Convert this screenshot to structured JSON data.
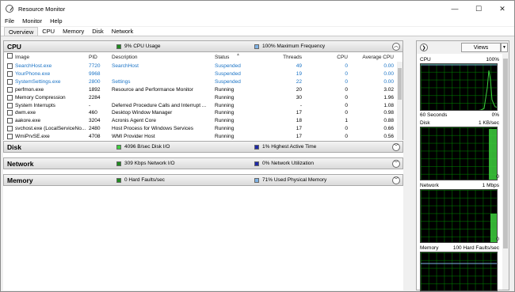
{
  "window": {
    "title": "Resource Monitor",
    "controls": [
      "—",
      "☐",
      "✕"
    ]
  },
  "menu": [
    "File",
    "Monitor",
    "Help"
  ],
  "tabs": [
    "Overview",
    "CPU",
    "Memory",
    "Disk",
    "Network"
  ],
  "cpu": {
    "title": "CPU",
    "stat1": "9% CPU Usage",
    "stat2": "100% Maximum Frequency",
    "stat1_color": "#1f8a1f",
    "stat2_color": "#7fb3e6",
    "columns": [
      "Image",
      "PID",
      "Description",
      "Status",
      "Threads",
      "CPU",
      "Average CPU"
    ],
    "rows": [
      {
        "image": "SearchHost.exe",
        "pid": "7720",
        "desc": "SearchHost",
        "status": "Suspended",
        "threads": "49",
        "cpu": "0",
        "avg": "0.00"
      },
      {
        "image": "YourPhone.exe",
        "pid": "9968",
        "desc": "",
        "status": "Suspended",
        "threads": "19",
        "cpu": "0",
        "avg": "0.00"
      },
      {
        "image": "SystemSettings.exe",
        "pid": "2800",
        "desc": "Settings",
        "status": "Suspended",
        "threads": "22",
        "cpu": "0",
        "avg": "0.00"
      },
      {
        "image": "perfmon.exe",
        "pid": "1892",
        "desc": "Resource and Performance Monitor",
        "status": "Running",
        "threads": "20",
        "cpu": "0",
        "avg": "3.02"
      },
      {
        "image": "Memory Compression",
        "pid": "2284",
        "desc": "",
        "status": "Running",
        "threads": "30",
        "cpu": "0",
        "avg": "1.96"
      },
      {
        "image": "System Interrupts",
        "pid": "-",
        "desc": "Deferred Procedure Calls and Interrupt ...",
        "status": "Running",
        "threads": "-",
        "cpu": "0",
        "avg": "1.08"
      },
      {
        "image": "dwm.exe",
        "pid": "460",
        "desc": "Desktop Window Manager",
        "status": "Running",
        "threads": "17",
        "cpu": "0",
        "avg": "0.98"
      },
      {
        "image": "aakore.exe",
        "pid": "3204",
        "desc": "Acronis Agent Core",
        "status": "Running",
        "threads": "18",
        "cpu": "1",
        "avg": "0.88"
      },
      {
        "image": "svchost.exe (LocalServiceNo...",
        "pid": "2480",
        "desc": "Host Process for Windows Services",
        "status": "Running",
        "threads": "17",
        "cpu": "0",
        "avg": "0.66"
      },
      {
        "image": "WmiPrvSE.exe",
        "pid": "4708",
        "desc": "WMI Provider Host",
        "status": "Running",
        "threads": "17",
        "cpu": "0",
        "avg": "0.56"
      }
    ]
  },
  "disk": {
    "title": "Disk",
    "stat1": "4096 B/sec Disk I/O",
    "stat2": "1% Highest Active Time",
    "stat1_color": "#3ecf3e",
    "stat2_color": "#1f2aa8"
  },
  "network": {
    "title": "Network",
    "stat1": "309 Kbps Network I/O",
    "stat2": "0% Network Utilization",
    "stat1_color": "#1f8a1f",
    "stat2_color": "#1f2aa8"
  },
  "memory": {
    "title": "Memory",
    "stat1": "0 Hard Faults/sec",
    "stat2": "71% Used Physical Memory",
    "stat1_color": "#1f8a1f",
    "stat2_color": "#7fb3e6"
  },
  "sidebar": {
    "views_label": "Views",
    "graphs": {
      "cpu": {
        "label": "CPU",
        "max": "100%",
        "bottom_left": "60 Seconds",
        "bottom_right": "0%"
      },
      "disk": {
        "label": "Disk",
        "max": "1 KB/sec",
        "bottom_right": "0"
      },
      "network": {
        "label": "Network",
        "max": "1 Mbps",
        "bottom_right": "0"
      },
      "memory": {
        "label": "Memory",
        "max": "100 Hard Faults/sec"
      }
    }
  }
}
